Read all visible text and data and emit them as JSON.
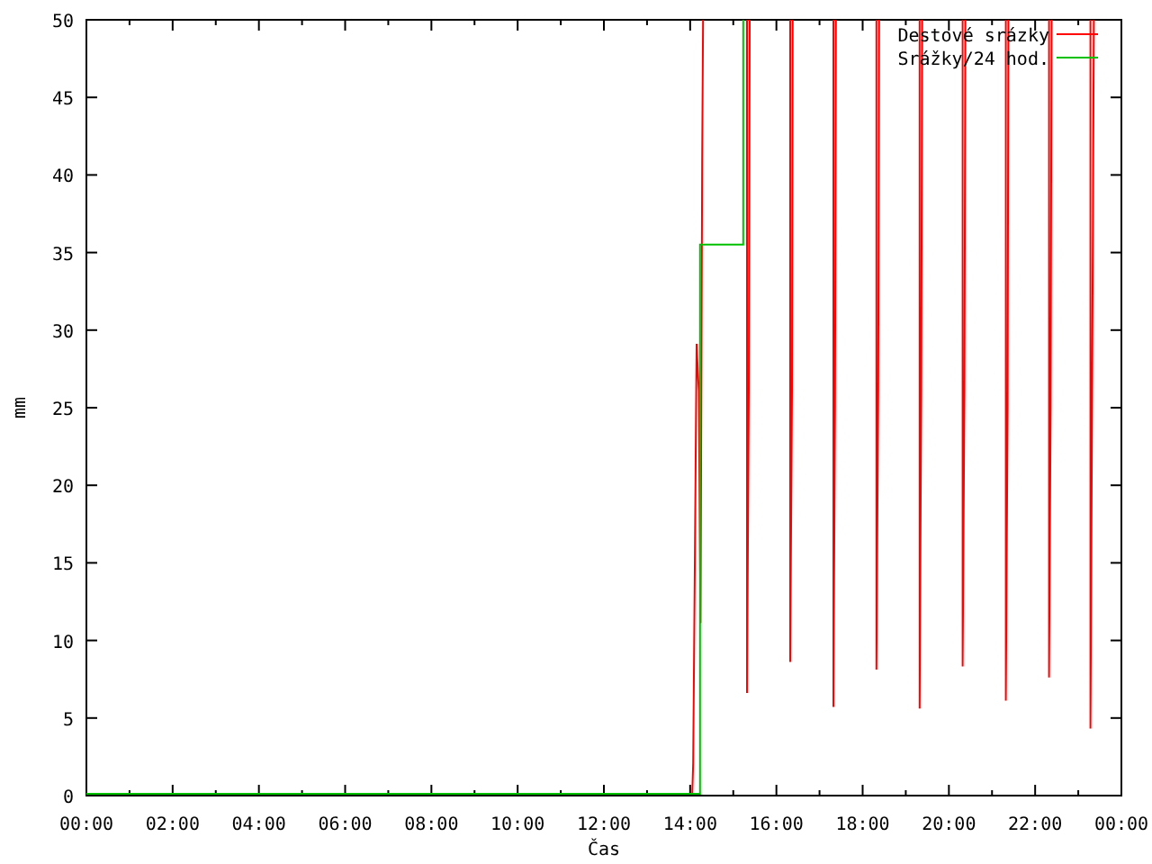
{
  "chart_data": {
    "type": "line",
    "legend": true,
    "xlabel": "Čas",
    "ylabel": "mm",
    "xlim": [
      0,
      24
    ],
    "ylim": [
      0,
      50
    ],
    "xticks": [
      {
        "value": 0,
        "label": "00:00"
      },
      {
        "value": 2,
        "label": "02:00"
      },
      {
        "value": 4,
        "label": "04:00"
      },
      {
        "value": 6,
        "label": "06:00"
      },
      {
        "value": 8,
        "label": "08:00"
      },
      {
        "value": 10,
        "label": "10:00"
      },
      {
        "value": 12,
        "label": "12:00"
      },
      {
        "value": 14,
        "label": "14:00"
      },
      {
        "value": 16,
        "label": "16:00"
      },
      {
        "value": 18,
        "label": "18:00"
      },
      {
        "value": 20,
        "label": "20:00"
      },
      {
        "value": 22,
        "label": "22:00"
      },
      {
        "value": 24,
        "label": "00:00"
      }
    ],
    "yticks": [
      0,
      5,
      10,
      15,
      20,
      25,
      30,
      35,
      40,
      45,
      50
    ],
    "series": [
      {
        "name": "Destové srázky",
        "color": "#ff0000",
        "x": [
          14.05,
          14.07,
          14.11,
          14.15,
          14.2,
          14.24,
          14.28,
          14.3,
          15.32,
          15.32,
          15.36,
          15.38,
          16.32,
          16.32,
          16.36,
          16.38,
          17.32,
          17.32,
          17.36,
          17.38,
          18.32,
          18.32,
          18.36,
          18.38,
          19.32,
          19.32,
          19.36,
          19.38,
          20.32,
          20.32,
          20.36,
          20.38,
          21.32,
          21.32,
          21.36,
          21.38,
          22.32,
          22.32,
          22.36,
          22.38,
          23.28,
          23.28,
          23.32,
          23.36
        ],
        "values": [
          0,
          2,
          16,
          29,
          26,
          11,
          41,
          50,
          50,
          6.5,
          26,
          50,
          50,
          8.5,
          26,
          50,
          50,
          5.6,
          25,
          50,
          50,
          8,
          26,
          50,
          50,
          5.5,
          26,
          50,
          50,
          8.2,
          26,
          50,
          50,
          6,
          25,
          50,
          50,
          7.5,
          25,
          50,
          50,
          4.2,
          25,
          50
        ]
      },
      {
        "name": "Srážky/24 hod.",
        "color": "#00c000",
        "x": [
          0,
          14.23,
          14.23,
          15.23,
          15.23
        ],
        "values": [
          0,
          0,
          35.4,
          35.4,
          50
        ]
      }
    ]
  }
}
